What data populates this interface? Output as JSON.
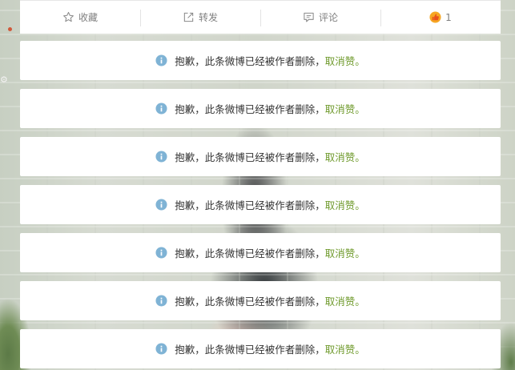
{
  "toolbar": {
    "favorite_label": "收藏",
    "repost_label": "转发",
    "comment_label": "评论",
    "like_count": "1"
  },
  "deleted_notice": {
    "message": "抱歉，此条微博已经被作者删除，",
    "cancel_like": "取消赞",
    "end_punct": "。"
  },
  "cards": [
    {
      "message": "抱歉，此条微博已经被作者删除，",
      "cancel_like": "取消赞",
      "end_punct": "。"
    },
    {
      "message": "抱歉，此条微博已经被作者删除，",
      "cancel_like": "取消赞",
      "end_punct": "。"
    },
    {
      "message": "抱歉，此条微博已经被作者删除，",
      "cancel_like": "取消赞",
      "end_punct": "。"
    },
    {
      "message": "抱歉，此条微博已经被作者删除，",
      "cancel_like": "取消赞",
      "end_punct": "。"
    },
    {
      "message": "抱歉，此条微博已经被作者删除，",
      "cancel_like": "取消赞",
      "end_punct": "。"
    },
    {
      "message": "抱歉，此条微博已经被作者删除，",
      "cancel_like": "取消赞",
      "end_punct": "。"
    },
    {
      "message": "抱歉，此条微博已经被作者删除，",
      "cancel_like": "取消赞",
      "end_punct": "。"
    }
  ],
  "colors": {
    "link_green": "#6f9a2c",
    "info_blue": "#7fb3d5",
    "like_orange": "#f08a24",
    "toolbar_text": "#808080"
  },
  "icons": {
    "favorite": "star-outline-icon",
    "repost": "share-arrow-icon",
    "comment": "comment-bubble-icon",
    "like": "thumbs-up-icon",
    "info": "info-circle-icon"
  }
}
